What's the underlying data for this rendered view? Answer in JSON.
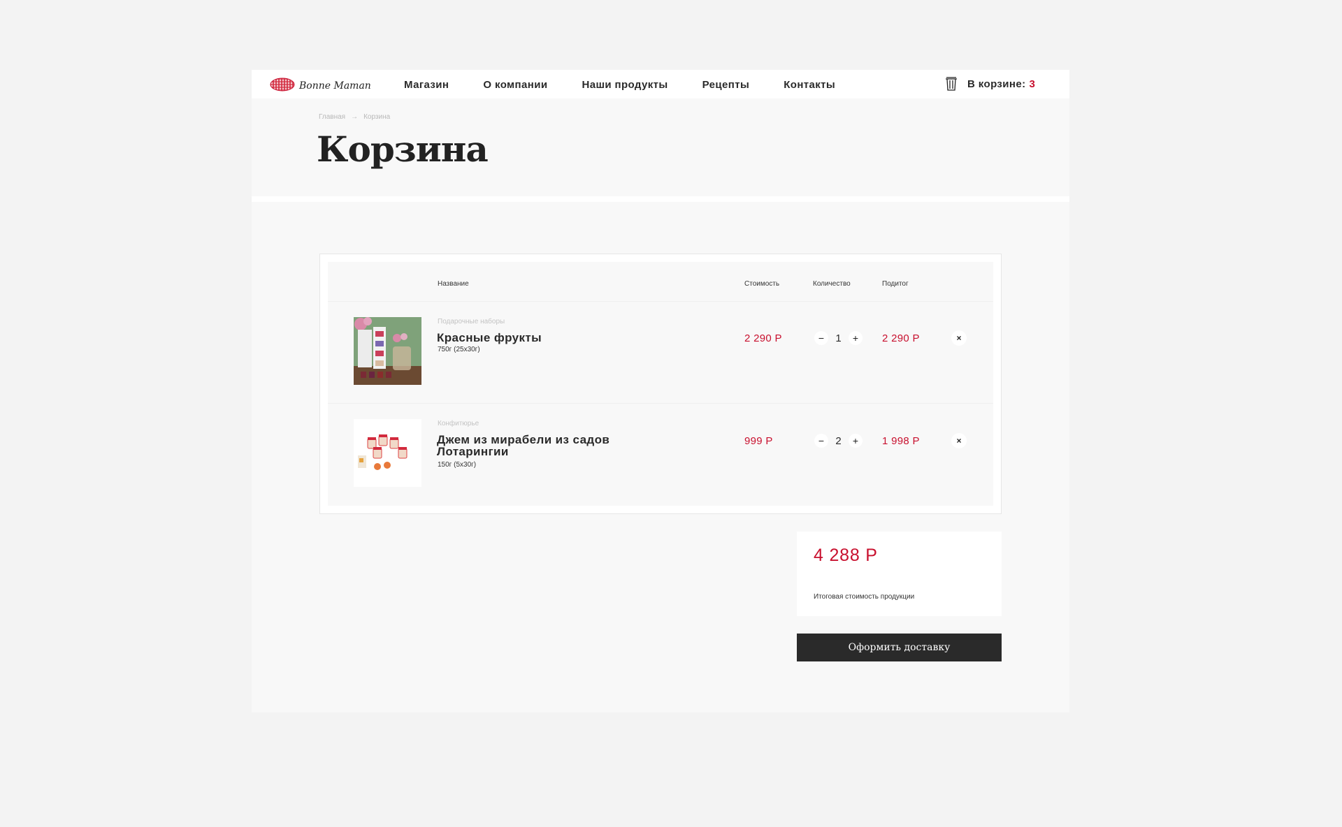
{
  "header": {
    "logo_text": "Bonne Maman",
    "nav": [
      "Магазин",
      "О компании",
      "Наши продукты",
      "Рецепты",
      "Контакты"
    ],
    "cart_label": "В корзине:",
    "cart_count": "3"
  },
  "breadcrumb": {
    "home": "Главная",
    "separator": "→",
    "current": "Корзина"
  },
  "page_title": "Корзина",
  "table": {
    "headers": {
      "name": "Название",
      "price": "Стоимость",
      "quantity": "Количество",
      "subtotal": "Подитог"
    },
    "items": [
      {
        "category": "Подарочные наборы",
        "name": "Красные фрукты",
        "size": "750г (25x30г)",
        "price": "2 290 Р",
        "quantity": "1",
        "subtotal": "2 290 Р",
        "image": "gift-set-product-image"
      },
      {
        "category": "Конфитюрье",
        "name": "Джем из мирабели из садов Лотарингии",
        "size": "150г (5x30г)",
        "price": "999 Р",
        "quantity": "2",
        "subtotal": "1 998 Р",
        "image": "mirabelle-jam-product-image"
      }
    ],
    "qty_minus": "−",
    "qty_plus": "+",
    "remove_symbol": "×"
  },
  "total": {
    "amount": "4 288 Р",
    "label": "Итоговая стоимость продукции"
  },
  "checkout_label": "Оформить доставку",
  "colors": {
    "accent": "#c8102e",
    "dark": "#2a2a2a",
    "page_bg": "#f3f3f3",
    "panel_bg": "#f8f8f8"
  }
}
